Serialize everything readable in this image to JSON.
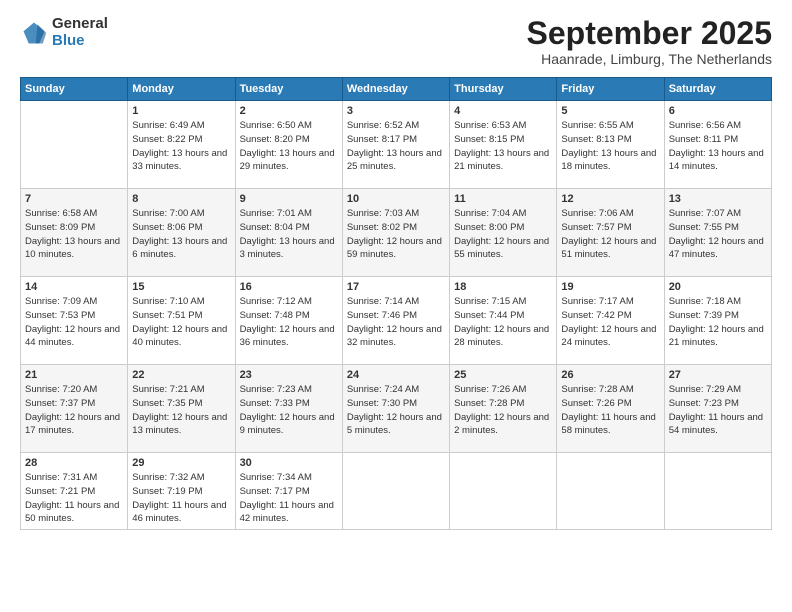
{
  "logo": {
    "general": "General",
    "blue": "Blue"
  },
  "title": "September 2025",
  "subtitle": "Haanrade, Limburg, The Netherlands",
  "headers": [
    "Sunday",
    "Monday",
    "Tuesday",
    "Wednesday",
    "Thursday",
    "Friday",
    "Saturday"
  ],
  "weeks": [
    [
      {
        "day": "",
        "sunrise": "",
        "sunset": "",
        "daylight": ""
      },
      {
        "day": "1",
        "sunrise": "Sunrise: 6:49 AM",
        "sunset": "Sunset: 8:22 PM",
        "daylight": "Daylight: 13 hours and 33 minutes."
      },
      {
        "day": "2",
        "sunrise": "Sunrise: 6:50 AM",
        "sunset": "Sunset: 8:20 PM",
        "daylight": "Daylight: 13 hours and 29 minutes."
      },
      {
        "day": "3",
        "sunrise": "Sunrise: 6:52 AM",
        "sunset": "Sunset: 8:17 PM",
        "daylight": "Daylight: 13 hours and 25 minutes."
      },
      {
        "day": "4",
        "sunrise": "Sunrise: 6:53 AM",
        "sunset": "Sunset: 8:15 PM",
        "daylight": "Daylight: 13 hours and 21 minutes."
      },
      {
        "day": "5",
        "sunrise": "Sunrise: 6:55 AM",
        "sunset": "Sunset: 8:13 PM",
        "daylight": "Daylight: 13 hours and 18 minutes."
      },
      {
        "day": "6",
        "sunrise": "Sunrise: 6:56 AM",
        "sunset": "Sunset: 8:11 PM",
        "daylight": "Daylight: 13 hours and 14 minutes."
      }
    ],
    [
      {
        "day": "7",
        "sunrise": "Sunrise: 6:58 AM",
        "sunset": "Sunset: 8:09 PM",
        "daylight": "Daylight: 13 hours and 10 minutes."
      },
      {
        "day": "8",
        "sunrise": "Sunrise: 7:00 AM",
        "sunset": "Sunset: 8:06 PM",
        "daylight": "Daylight: 13 hours and 6 minutes."
      },
      {
        "day": "9",
        "sunrise": "Sunrise: 7:01 AM",
        "sunset": "Sunset: 8:04 PM",
        "daylight": "Daylight: 13 hours and 3 minutes."
      },
      {
        "day": "10",
        "sunrise": "Sunrise: 7:03 AM",
        "sunset": "Sunset: 8:02 PM",
        "daylight": "Daylight: 12 hours and 59 minutes."
      },
      {
        "day": "11",
        "sunrise": "Sunrise: 7:04 AM",
        "sunset": "Sunset: 8:00 PM",
        "daylight": "Daylight: 12 hours and 55 minutes."
      },
      {
        "day": "12",
        "sunrise": "Sunrise: 7:06 AM",
        "sunset": "Sunset: 7:57 PM",
        "daylight": "Daylight: 12 hours and 51 minutes."
      },
      {
        "day": "13",
        "sunrise": "Sunrise: 7:07 AM",
        "sunset": "Sunset: 7:55 PM",
        "daylight": "Daylight: 12 hours and 47 minutes."
      }
    ],
    [
      {
        "day": "14",
        "sunrise": "Sunrise: 7:09 AM",
        "sunset": "Sunset: 7:53 PM",
        "daylight": "Daylight: 12 hours and 44 minutes."
      },
      {
        "day": "15",
        "sunrise": "Sunrise: 7:10 AM",
        "sunset": "Sunset: 7:51 PM",
        "daylight": "Daylight: 12 hours and 40 minutes."
      },
      {
        "day": "16",
        "sunrise": "Sunrise: 7:12 AM",
        "sunset": "Sunset: 7:48 PM",
        "daylight": "Daylight: 12 hours and 36 minutes."
      },
      {
        "day": "17",
        "sunrise": "Sunrise: 7:14 AM",
        "sunset": "Sunset: 7:46 PM",
        "daylight": "Daylight: 12 hours and 32 minutes."
      },
      {
        "day": "18",
        "sunrise": "Sunrise: 7:15 AM",
        "sunset": "Sunset: 7:44 PM",
        "daylight": "Daylight: 12 hours and 28 minutes."
      },
      {
        "day": "19",
        "sunrise": "Sunrise: 7:17 AM",
        "sunset": "Sunset: 7:42 PM",
        "daylight": "Daylight: 12 hours and 24 minutes."
      },
      {
        "day": "20",
        "sunrise": "Sunrise: 7:18 AM",
        "sunset": "Sunset: 7:39 PM",
        "daylight": "Daylight: 12 hours and 21 minutes."
      }
    ],
    [
      {
        "day": "21",
        "sunrise": "Sunrise: 7:20 AM",
        "sunset": "Sunset: 7:37 PM",
        "daylight": "Daylight: 12 hours and 17 minutes."
      },
      {
        "day": "22",
        "sunrise": "Sunrise: 7:21 AM",
        "sunset": "Sunset: 7:35 PM",
        "daylight": "Daylight: 12 hours and 13 minutes."
      },
      {
        "day": "23",
        "sunrise": "Sunrise: 7:23 AM",
        "sunset": "Sunset: 7:33 PM",
        "daylight": "Daylight: 12 hours and 9 minutes."
      },
      {
        "day": "24",
        "sunrise": "Sunrise: 7:24 AM",
        "sunset": "Sunset: 7:30 PM",
        "daylight": "Daylight: 12 hours and 5 minutes."
      },
      {
        "day": "25",
        "sunrise": "Sunrise: 7:26 AM",
        "sunset": "Sunset: 7:28 PM",
        "daylight": "Daylight: 12 hours and 2 minutes."
      },
      {
        "day": "26",
        "sunrise": "Sunrise: 7:28 AM",
        "sunset": "Sunset: 7:26 PM",
        "daylight": "Daylight: 11 hours and 58 minutes."
      },
      {
        "day": "27",
        "sunrise": "Sunrise: 7:29 AM",
        "sunset": "Sunset: 7:23 PM",
        "daylight": "Daylight: 11 hours and 54 minutes."
      }
    ],
    [
      {
        "day": "28",
        "sunrise": "Sunrise: 7:31 AM",
        "sunset": "Sunset: 7:21 PM",
        "daylight": "Daylight: 11 hours and 50 minutes."
      },
      {
        "day": "29",
        "sunrise": "Sunrise: 7:32 AM",
        "sunset": "Sunset: 7:19 PM",
        "daylight": "Daylight: 11 hours and 46 minutes."
      },
      {
        "day": "30",
        "sunrise": "Sunrise: 7:34 AM",
        "sunset": "Sunset: 7:17 PM",
        "daylight": "Daylight: 11 hours and 42 minutes."
      },
      {
        "day": "",
        "sunrise": "",
        "sunset": "",
        "daylight": ""
      },
      {
        "day": "",
        "sunrise": "",
        "sunset": "",
        "daylight": ""
      },
      {
        "day": "",
        "sunrise": "",
        "sunset": "",
        "daylight": ""
      },
      {
        "day": "",
        "sunrise": "",
        "sunset": "",
        "daylight": ""
      }
    ]
  ]
}
